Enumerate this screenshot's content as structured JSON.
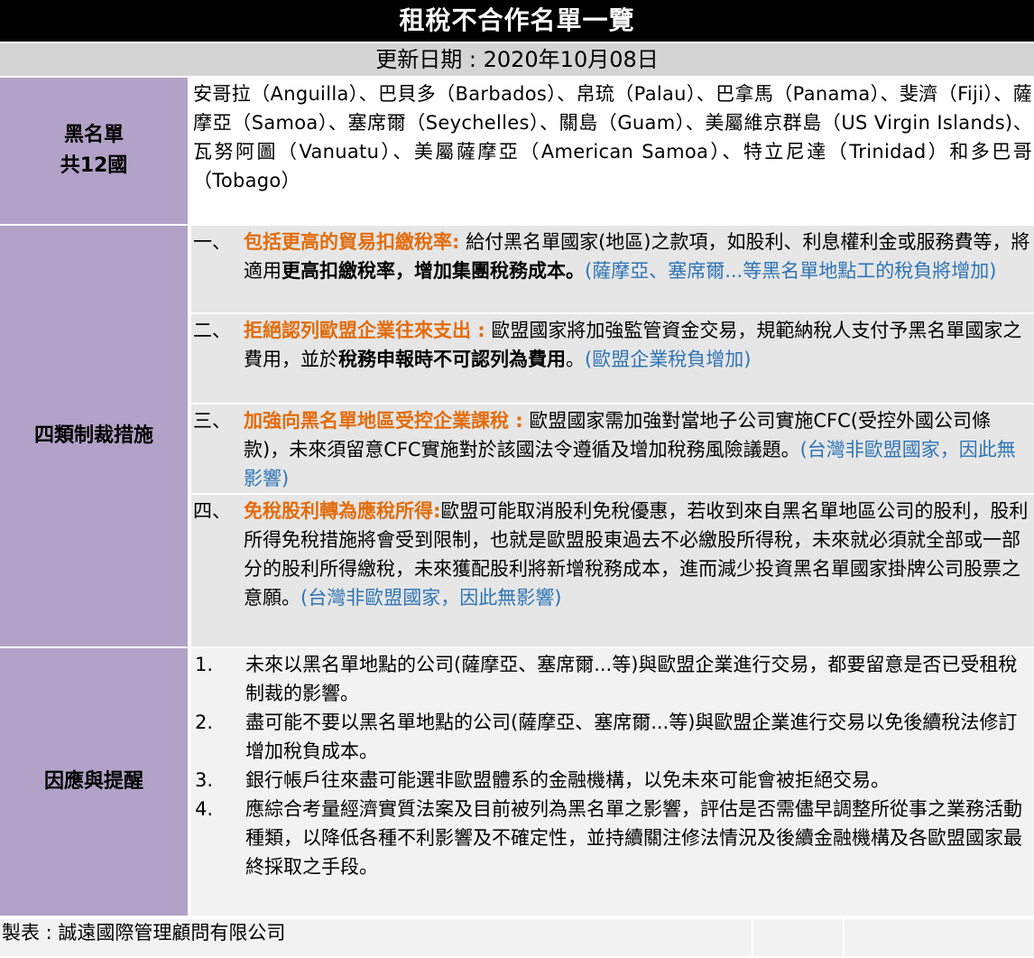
{
  "title": "租稅不合作名單一覽",
  "update": "更新日期 : 2020年10月08日",
  "blacklist": {
    "label_line1": "黑名單",
    "label_line2": "共12國",
    "text": "安哥拉（Anguilla）、巴貝多（Barbados）、帛琉（Palau）、巴拿馬（Panama）、斐濟（Fiji）、薩摩亞（Samoa）、塞席爾（Seychelles）、關島（Guam）、美屬維京群島（US Virgin Islands)、瓦努阿圖（Vanuatu）、美屬薩摩亞（American Samoa）、特立尼達（Trinidad）和多巴哥（Tobago）"
  },
  "measures": {
    "label": "四類制裁措施",
    "items": [
      {
        "num": "一、",
        "heading": "包括更高的貿易扣繳稅率:",
        "body1": " 給付黑名單國家(地區)之款項，如股利、利息權利金或服務費等，將適用",
        "bold": "更高扣繳稅率，增加集團稅務成本。",
        "note": "(薩摩亞、塞席爾...等黑名單地點工的稅負將增加)"
      },
      {
        "num": "二、",
        "heading": "拒絕認列歐盟企業往來支出 :",
        "body1": " 歐盟國家將加強監管資金交易，規範納稅人支付予黑名單國家之費用，並於",
        "bold": "稅務申報時不可認列為費用",
        "body2": "。",
        "note": "(歐盟企業稅負增加)"
      },
      {
        "num": "三、",
        "heading": "加強向黑名單地區受控企業課稅 :",
        "body1": " 歐盟國家需加強對當地子公司實施CFC(受控外國公司條款)，未來須留意CFC實施對於該國法令遵循及增加稅務風險議題。",
        "note": "(台灣非歐盟國家，因此無影響)"
      },
      {
        "num": "四、",
        "heading": "免稅股利轉為應稅所得:",
        "body1": "歐盟可能取消股利免稅優惠，若收到來自黑名單地區公司的股利，股利所得免稅措施將會受到限制，也就是歐盟股東過去不必繳股所得稅，未來就必須就全部或一部分的股利所得繳稅，未來獲配股利將新增稅務成本，進而減少投資黑名單國家掛牌公司股票之意願。",
        "note": "(台灣非歐盟國家，因此無影響)"
      }
    ]
  },
  "response": {
    "label": "因應與提醒",
    "items": [
      {
        "num": "1.",
        "text": "未來以黑名單地點的公司(薩摩亞、塞席爾...等)與歐盟企業進行交易，都要留意是否已受租稅制裁的影響。"
      },
      {
        "num": "2.",
        "text": "盡可能不要以黑名單地點的公司(薩摩亞、塞席爾...等)與歐盟企業進行交易以免後續稅法修訂增加稅負成本。"
      },
      {
        "num": "3.",
        "text": "銀行帳戶往來盡可能選非歐盟體系的金融機構，以免未來可能會被拒絕交易。"
      },
      {
        "num": "4.",
        "text": "應綜合考量經濟實質法案及目前被列為黑名單之影響，評估是否需儘早調整所從事之業務活動種類，以降低各種不利影響及不確定性，並持續關注修法情況及後續金融機構及各歐盟國家最終採取之手段。"
      }
    ]
  },
  "footer": {
    "credit": "製表 : 誠遠國際管理顧問有限公司"
  }
}
